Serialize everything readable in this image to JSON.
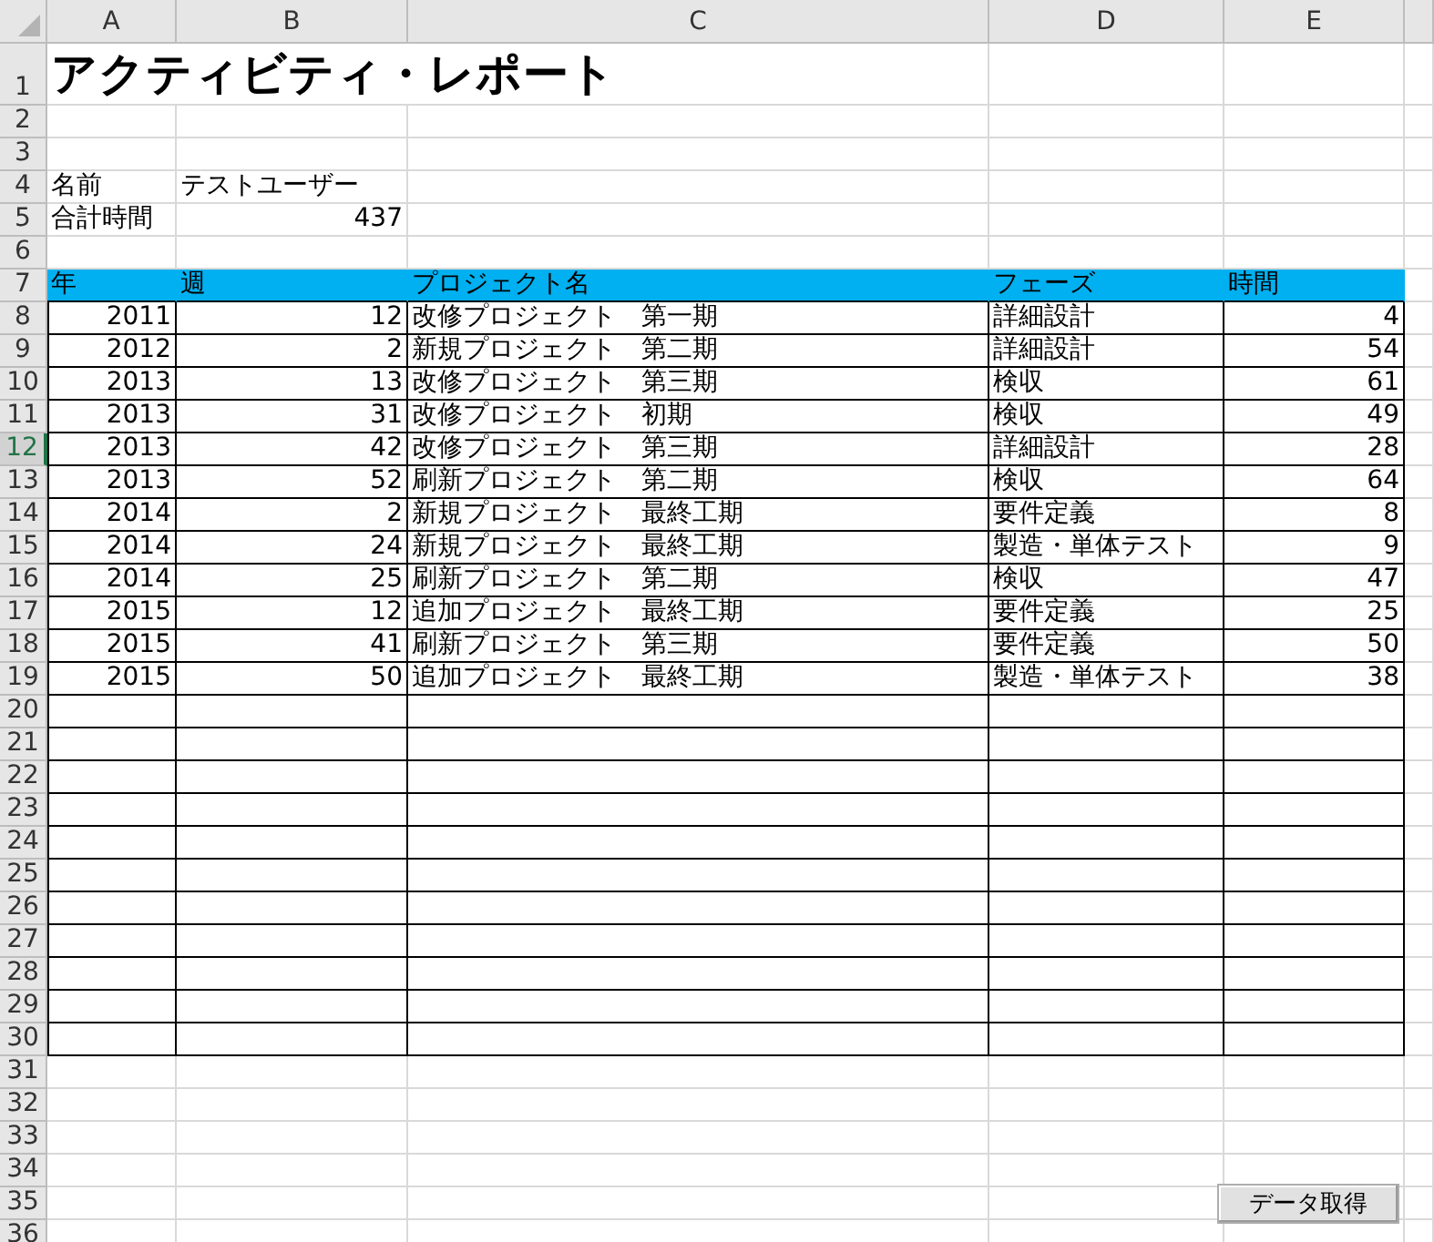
{
  "column_headers": [
    "A",
    "B",
    "C",
    "D",
    "E"
  ],
  "rows": [
    {
      "header": "1",
      "kind": "title",
      "selected": false,
      "text": "アクティビティ・レポート"
    },
    {
      "header": "2",
      "kind": "blank",
      "selected": false
    },
    {
      "header": "3",
      "kind": "blank",
      "selected": false
    },
    {
      "header": "4",
      "kind": "info",
      "selected": false,
      "label": "名前",
      "value": "テストユーザー",
      "numeric": false
    },
    {
      "header": "5",
      "kind": "info",
      "selected": false,
      "label": "合計時間",
      "value": "437",
      "numeric": true
    },
    {
      "header": "6",
      "kind": "blank",
      "selected": false
    },
    {
      "header": "7",
      "kind": "table-head",
      "selected": false,
      "cells": [
        "年",
        "週",
        "プロジェクト名",
        "フェーズ",
        "時間"
      ]
    },
    {
      "header": "8",
      "kind": "table-row",
      "selected": false,
      "cells": [
        "2011",
        "12",
        "改修プロジェクト　第一期",
        "詳細設計",
        "4"
      ]
    },
    {
      "header": "9",
      "kind": "table-row",
      "selected": false,
      "cells": [
        "2012",
        "2",
        "新規プロジェクト　第二期",
        "詳細設計",
        "54"
      ]
    },
    {
      "header": "10",
      "kind": "table-row",
      "selected": false,
      "cells": [
        "2013",
        "13",
        "改修プロジェクト　第三期",
        "検収",
        "61"
      ]
    },
    {
      "header": "11",
      "kind": "table-row",
      "selected": false,
      "cells": [
        "2013",
        "31",
        "改修プロジェクト　初期",
        "検収",
        "49"
      ]
    },
    {
      "header": "12",
      "kind": "table-row",
      "selected": true,
      "cells": [
        "2013",
        "42",
        "改修プロジェクト　第三期",
        "詳細設計",
        "28"
      ]
    },
    {
      "header": "13",
      "kind": "table-row",
      "selected": false,
      "cells": [
        "2013",
        "52",
        "刷新プロジェクト　第二期",
        "検収",
        "64"
      ]
    },
    {
      "header": "14",
      "kind": "table-row",
      "selected": false,
      "cells": [
        "2014",
        "2",
        "新規プロジェクト　最終工期",
        "要件定義",
        "8"
      ]
    },
    {
      "header": "15",
      "kind": "table-row",
      "selected": false,
      "cells": [
        "2014",
        "24",
        "新規プロジェクト　最終工期",
        "製造・単体テスト",
        "9"
      ]
    },
    {
      "header": "16",
      "kind": "table-row",
      "selected": false,
      "cells": [
        "2014",
        "25",
        "刷新プロジェクト　第二期",
        "検収",
        "47"
      ]
    },
    {
      "header": "17",
      "kind": "table-row",
      "selected": false,
      "cells": [
        "2015",
        "12",
        "追加プロジェクト　最終工期",
        "要件定義",
        "25"
      ]
    },
    {
      "header": "18",
      "kind": "table-row",
      "selected": false,
      "cells": [
        "2015",
        "41",
        "刷新プロジェクト　第三期",
        "要件定義",
        "50"
      ]
    },
    {
      "header": "19",
      "kind": "table-row",
      "selected": false,
      "cells": [
        "2015",
        "50",
        "追加プロジェクト　最終工期",
        "製造・単体テスト",
        "38"
      ]
    },
    {
      "header": "20",
      "kind": "table-blank",
      "selected": false
    },
    {
      "header": "21",
      "kind": "table-blank",
      "selected": false
    },
    {
      "header": "22",
      "kind": "table-blank",
      "selected": false
    },
    {
      "header": "23",
      "kind": "table-blank",
      "selected": false
    },
    {
      "header": "24",
      "kind": "table-blank",
      "selected": false
    },
    {
      "header": "25",
      "kind": "table-blank",
      "selected": false
    },
    {
      "header": "26",
      "kind": "table-blank",
      "selected": false
    },
    {
      "header": "27",
      "kind": "table-blank",
      "selected": false
    },
    {
      "header": "28",
      "kind": "table-blank",
      "selected": false
    },
    {
      "header": "29",
      "kind": "table-blank",
      "selected": false
    },
    {
      "header": "30",
      "kind": "table-blank",
      "selected": false
    },
    {
      "header": "31",
      "kind": "blank",
      "selected": false
    },
    {
      "header": "32",
      "kind": "blank",
      "selected": false
    },
    {
      "header": "33",
      "kind": "blank",
      "selected": false
    },
    {
      "header": "34",
      "kind": "blank",
      "selected": false
    },
    {
      "header": "35",
      "kind": "blank",
      "selected": false
    },
    {
      "header": "36",
      "kind": "blank",
      "selected": false
    }
  ],
  "button": {
    "label": "データ取得"
  }
}
